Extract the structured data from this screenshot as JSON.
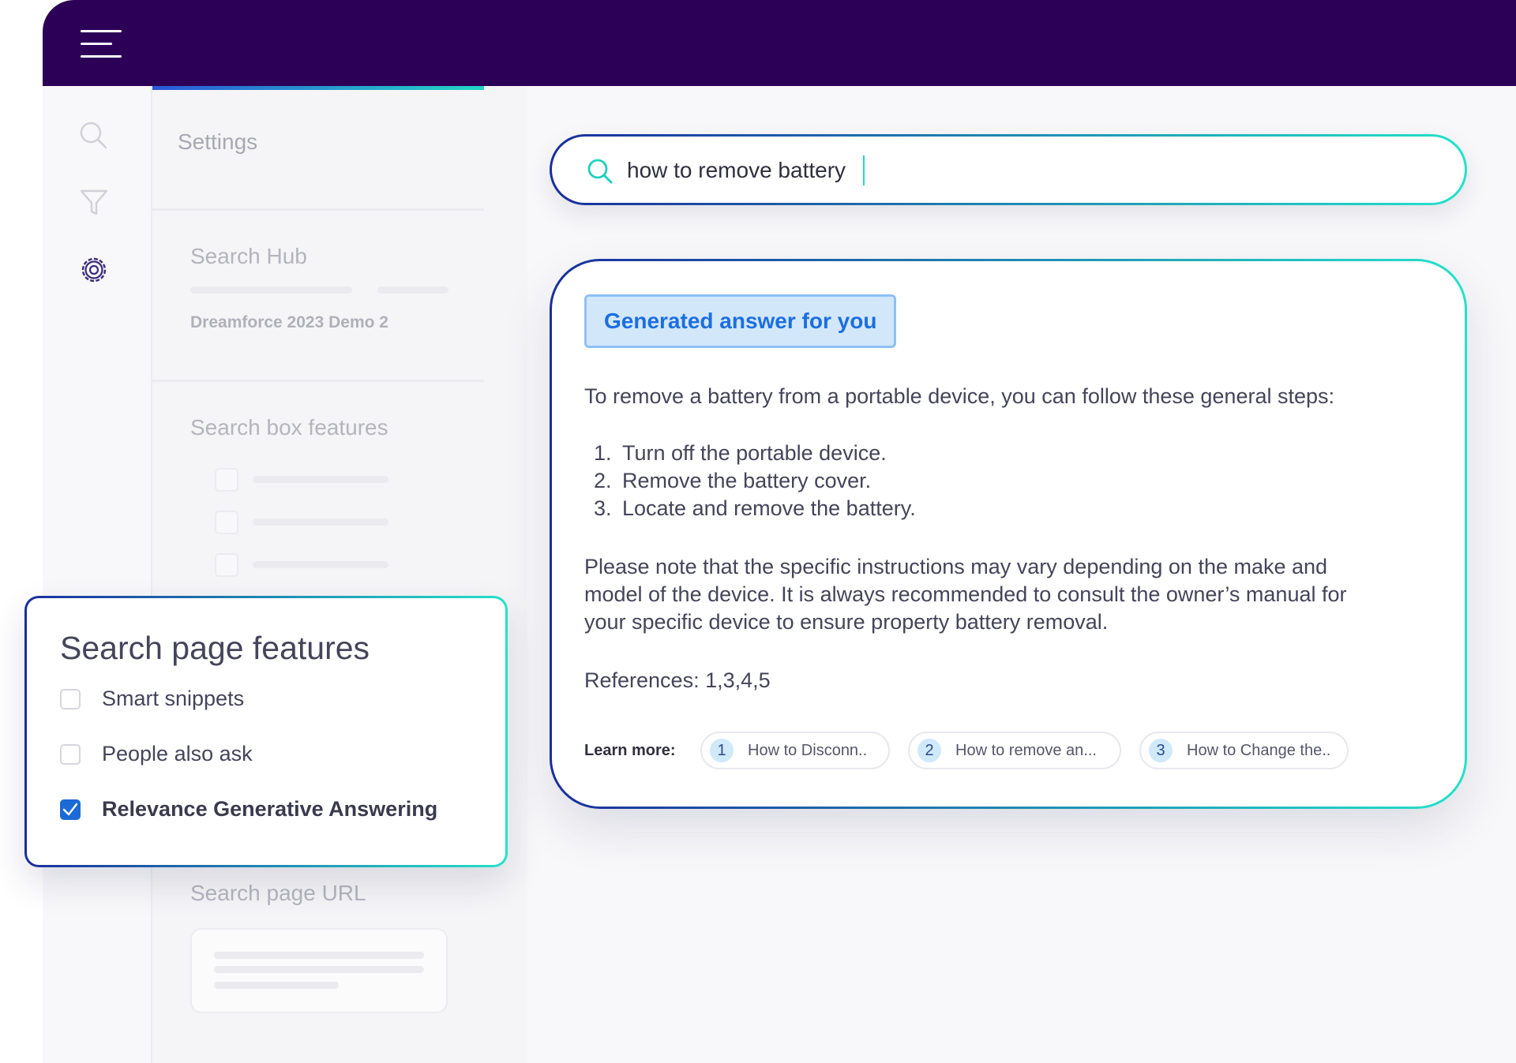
{
  "nav": {
    "menu_icon": "hamburger-menu-icon",
    "rail_icons": [
      "search-icon",
      "filter-icon",
      "gear-icon"
    ]
  },
  "settings_panel": {
    "title": "Settings",
    "search_hub": {
      "label": "Search Hub",
      "value": "Dreamforce 2023 Demo 2"
    },
    "search_box_features": {
      "label": "Search box features"
    },
    "search_page_url": {
      "label": "Search page URL"
    }
  },
  "search": {
    "query": "how to remove battery",
    "icon": "search-icon"
  },
  "answer": {
    "badge": "Generated answer for you",
    "intro": "To remove a battery from a portable device, you can follow these general steps:",
    "steps": [
      {
        "num": "1.",
        "text": "Turn off the portable device."
      },
      {
        "num": "2.",
        "text": "Remove the battery cover."
      },
      {
        "num": "3.",
        "text": "Locate and remove the battery."
      }
    ],
    "note_lines": [
      "Please note that the specific instructions may vary depending on the make and",
      "model of the device. It is always recommended to consult the owner’s manual for",
      "your specific device to ensure property battery removal."
    ],
    "references": "References: 1,3,4,5",
    "learn_more_label": "Learn more:",
    "citations": [
      {
        "num": "1",
        "title": "How to Disconn.."
      },
      {
        "num": "2",
        "title": "How to remove an..."
      },
      {
        "num": "3",
        "title": "How to Change the.."
      }
    ]
  },
  "search_page_features": {
    "title": "Search page features",
    "options": [
      {
        "label": "Smart snippets",
        "checked": false
      },
      {
        "label": "People also ask",
        "checked": false
      },
      {
        "label": "Relevance Generative Answering",
        "checked": true
      }
    ]
  },
  "colors": {
    "topbar": "#2c0057",
    "accent_blue": "#1b6ee0",
    "gradient_start": "#1a2e9c",
    "gradient_end": "#24e2c9",
    "checkbox_checked": "#1c6ad6"
  }
}
